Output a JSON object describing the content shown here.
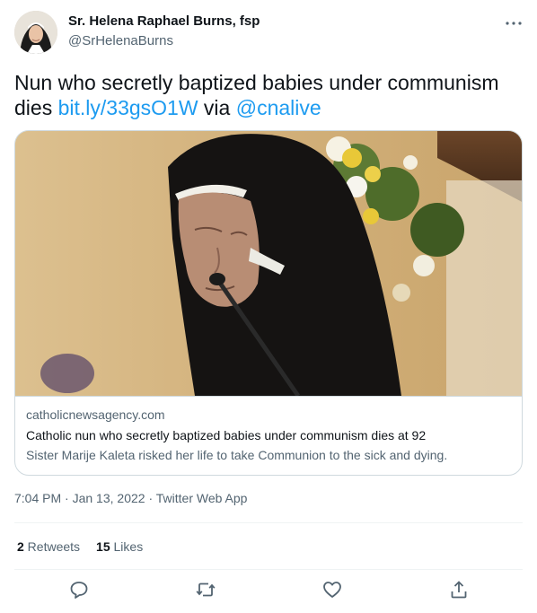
{
  "author": {
    "name": "Sr. Helena Raphael Burns, fsp",
    "handle": "@SrHelenaBurns"
  },
  "tweet": {
    "text_part1": "Nun who secretly baptized babies under communism dies ",
    "link": "bit.ly/33gsO1W",
    "text_part2": " via ",
    "mention": "@cnalive"
  },
  "card": {
    "domain": "catholicnewsagency.com",
    "title": "Catholic nun who secretly baptized babies under communism dies at 92",
    "description": "Sister Marije Kaleta risked her life to take Communion to the sick and dying."
  },
  "meta": {
    "time": "7:04 PM",
    "sep1": " · ",
    "date": "Jan 13, 2022",
    "sep2": " · ",
    "source": "Twitter Web App"
  },
  "stats": {
    "retweets_count": "2",
    "retweets_label": " Retweets",
    "likes_count": "15",
    "likes_label": " Likes"
  },
  "icons": {
    "more": "more-icon",
    "reply": "reply-icon",
    "retweet": "retweet-icon",
    "like": "heart-icon",
    "share": "share-icon"
  },
  "colors": {
    "link": "#1d9bf0",
    "secondary_text": "#536471",
    "border": "#cfd9de"
  }
}
